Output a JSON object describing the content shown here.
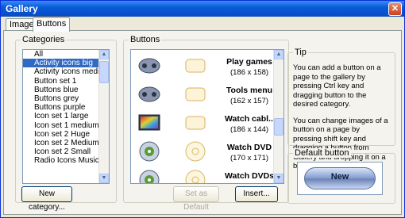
{
  "window": {
    "title": "Gallery",
    "close": "✕"
  },
  "tabs": [
    {
      "label": "Images"
    },
    {
      "label": "Buttons"
    }
  ],
  "categories": {
    "label": "Categories",
    "items": [
      "All",
      "Activity icons big",
      "Activity icons medium",
      "Button set 1",
      "Buttons blue",
      "Buttons grey",
      "Buttons purple",
      "Icon set 1 large",
      "Icon set 1 medium",
      "Icon set 2 Huge",
      "Icon set 2 Medium",
      "Icon set 2 Small",
      "Radio Icons Music Cho"
    ],
    "selected_index": 1,
    "new_button": "New category..."
  },
  "buttons_panel": {
    "label": "Buttons",
    "rows": [
      {
        "name": "Play games",
        "size": "(186 x 158)"
      },
      {
        "name": "Tools menu",
        "size": "(162 x 157)"
      },
      {
        "name": "Watch cabl...",
        "size": "(186 x 144)"
      },
      {
        "name": "Watch DVD",
        "size": "(170 x 171)"
      },
      {
        "name": "Watch DVDs",
        "size": ""
      }
    ],
    "set_default": "Set as Default",
    "insert": "Insert..."
  },
  "tip": {
    "label": "Tip",
    "text1": "You can add a button on a page to the gallery by pressing Ctrl key and dragging button to the desired category.",
    "text2": "You can change images of a button on a page by pressing shift key and dragging a button from Gallery and dropping it on a button on the page."
  },
  "default_button": {
    "label": "Default button",
    "text": "New"
  }
}
